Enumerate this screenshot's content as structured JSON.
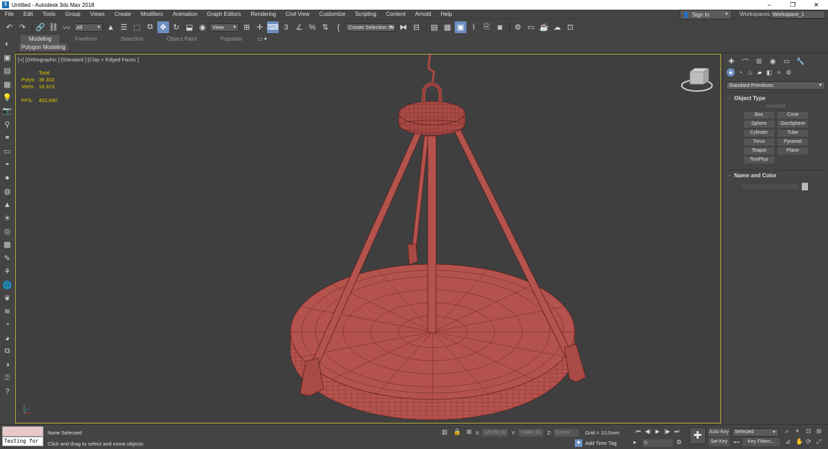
{
  "window": {
    "title": "Untitled - Autodesk 3ds Max 2018",
    "controls": [
      "–",
      "❐",
      "✕"
    ]
  },
  "menu": [
    "File",
    "Edit",
    "Tools",
    "Group",
    "Views",
    "Create",
    "Modifiers",
    "Animation",
    "Graph Editors",
    "Rendering",
    "Civil View",
    "Customize",
    "Scripting",
    "Content",
    "Arnold",
    "Help"
  ],
  "account": {
    "sign_in": "Sign In",
    "workspaces_label": "Workspaces:",
    "workspace": "Workspace_1"
  },
  "toolbar": {
    "selection_filter": "All",
    "reference_coord": "View",
    "snap_3": "3",
    "named_selection_set": "Create Selection Se"
  },
  "ribbon": {
    "tabs": [
      "Modeling",
      "Freeform",
      "Selection",
      "Object Paint",
      "Populate"
    ],
    "active_tab": "Modeling",
    "sub_label": "Polygon Modeling"
  },
  "viewport": {
    "label": "[+] [Orthographic ] [Standard ] [Clay + Edged Faces ]",
    "stats": {
      "total_label": "Total",
      "polys_label": "Polys:",
      "polys_value": "36 302",
      "verts_label": "Verts:",
      "verts_value": "18 313",
      "fps_label": "FPS:",
      "fps_value": "402,690"
    }
  },
  "command_panel": {
    "category_dropdown": "Standard Primitives",
    "object_type_title": "Object Type",
    "autogrid_label": "AutoGrid",
    "primitives": [
      "Box",
      "Cone",
      "Sphere",
      "GeoSphere",
      "Cylinder",
      "Tube",
      "Torus",
      "Pyramid",
      "Teapot",
      "Plane",
      "TextPlus"
    ],
    "name_color_title": "Name and Color"
  },
  "status": {
    "script_input": "Testing for ;",
    "selection_status": "None Selected",
    "prompt": "Click and drag to select and move objects",
    "x_label": "X:",
    "x_value": "129755,92",
    "y_label": "Y:",
    "y_value": "-18467,61",
    "z_label": "Z:",
    "z_value": "0,0mm",
    "grid": "Grid = 10,0mm",
    "add_time_tag": "Add Time Tag",
    "current_frame": "0",
    "auto_key": "Auto Key",
    "set_key": "Set Key",
    "key_mode": "Selected",
    "key_filters": "Key Filters..."
  },
  "colors": {
    "model": "#b4524d",
    "model_wire": "#5a1f1c",
    "viewport_bg": "#3f3f3f",
    "viewport_border": "#b4a93a",
    "stats_text": "#e0c800",
    "active_blue": "#6c8ec0"
  }
}
